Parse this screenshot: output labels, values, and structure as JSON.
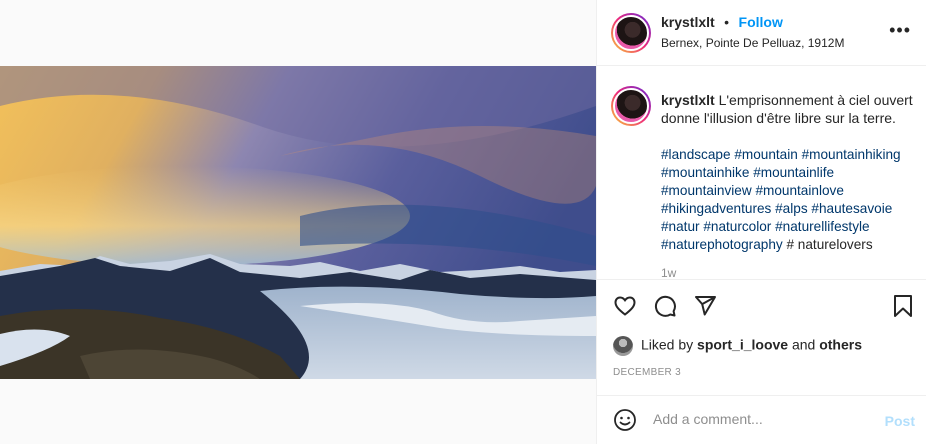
{
  "post": {
    "username": "krystlxlt",
    "separator": "•",
    "follow_label": "Follow",
    "location": "Bernex, Pointe De Pelluaz, 1912M",
    "more_label": "•••"
  },
  "caption": {
    "username": "krystlxlt",
    "text": "L'emprisonnement à ciel ouvert donne l'illusion d'être libre sur la terre.",
    "hashtags": [
      "#landscape",
      "#mountain",
      "#mountainhiking",
      "#mountainhike",
      "#mountainlife",
      "#mountainview",
      "#mountainlove",
      "#hikingadventures",
      "#alps",
      "#hautesavoie",
      "#natur",
      "#naturcolor",
      "#naturellifestyle",
      "#naturephotography"
    ],
    "trailing_text": "# naturelovers",
    "faded_text": "1w"
  },
  "actions": {
    "icons": [
      "heart-icon",
      "comment-icon",
      "share-icon",
      "bookmark-icon"
    ]
  },
  "likes": {
    "prefix": "Liked by",
    "user": "sport_i_loove",
    "connector": "and",
    "others": "others"
  },
  "date": "DECEMBER 3",
  "comment_box": {
    "placeholder": "Add a comment...",
    "post_label": "Post"
  },
  "colors": {
    "link": "#0095f6",
    "hashtag": "#00376b",
    "post_disabled": "#b2dffc"
  }
}
